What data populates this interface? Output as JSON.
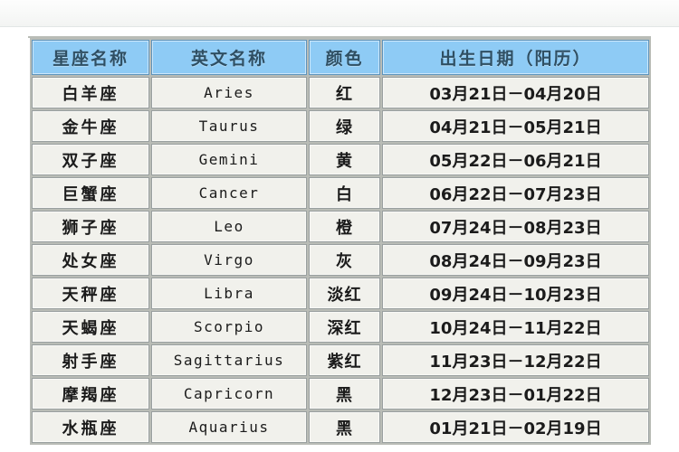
{
  "page": {
    "top_strip_text": "···· ·· ····"
  },
  "table": {
    "columns": [
      {
        "key": "name",
        "label": "星座名称"
      },
      {
        "key": "en",
        "label": "英文名称"
      },
      {
        "key": "color",
        "label": "颜色"
      },
      {
        "key": "date",
        "label": "出生日期（阳历）"
      }
    ],
    "rows": [
      {
        "name": "白羊座",
        "en": "Aries",
        "color": "红",
        "date": "03月21日－04月20日"
      },
      {
        "name": "金牛座",
        "en": "Taurus",
        "color": "绿",
        "date": "04月21日－05月21日"
      },
      {
        "name": "双子座",
        "en": "Gemini",
        "color": "黄",
        "date": "05月22日－06月21日"
      },
      {
        "name": "巨蟹座",
        "en": "Cancer",
        "color": "白",
        "date": "06月22日－07月23日"
      },
      {
        "name": "狮子座",
        "en": "Leo",
        "color": "橙",
        "date": "07月24日－08月23日"
      },
      {
        "name": "处女座",
        "en": "Virgo",
        "color": "灰",
        "date": "08月24日－09月23日"
      },
      {
        "name": "天秤座",
        "en": "Libra",
        "color": "淡红",
        "date": "09月24日－10月23日"
      },
      {
        "name": "天蝎座",
        "en": "Scorpio",
        "color": "深红",
        "date": "10月24日－11月22日"
      },
      {
        "name": "射手座",
        "en": "Sagittarius",
        "color": "紫红",
        "date": "11月23日－12月22日"
      },
      {
        "name": "摩羯座",
        "en": "Capricorn",
        "color": "黑",
        "date": "12月23日－01月22日"
      },
      {
        "name": "水瓶座",
        "en": "Aquarius",
        "color": "黑",
        "date": "01月21日－02月19日"
      }
    ]
  },
  "colors": {
    "header_blue": "#8ecbf5",
    "cell_bg": "#f1f1ec",
    "grid": "#b9bcb6",
    "page_bg": "#ffffff",
    "text": "#1b1b1b"
  }
}
